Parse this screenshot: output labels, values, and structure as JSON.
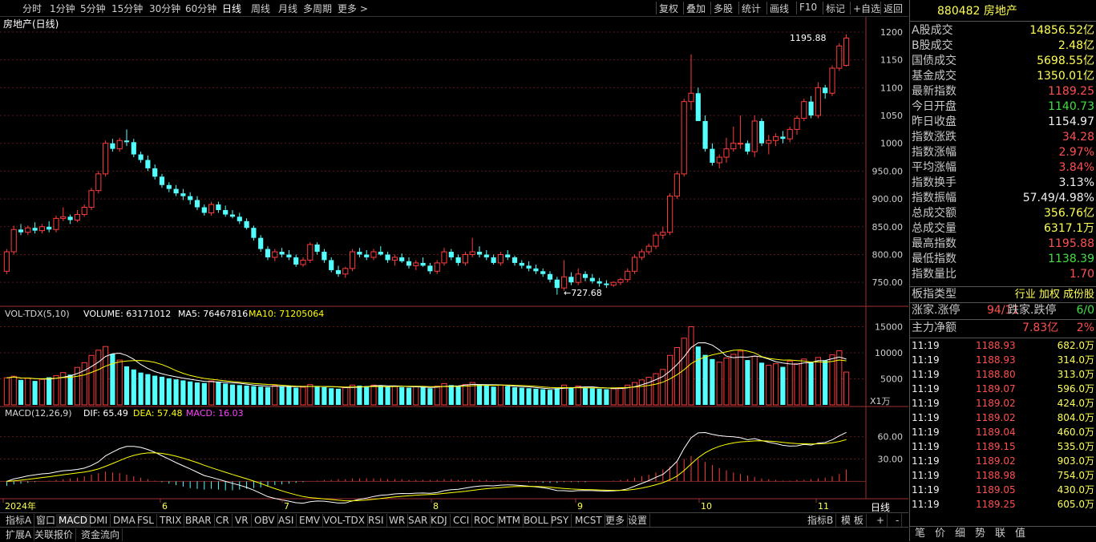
{
  "toolbar": {
    "periods": [
      "分时",
      "1分钟",
      "5分钟",
      "15分钟",
      "30分钟",
      "60分钟",
      "日线",
      "周线",
      "月线",
      "多周期",
      "更多 >"
    ],
    "active_period": "日线",
    "buttons": [
      "复权",
      "叠加",
      "多股",
      "统计",
      "画线",
      "F10",
      "标记",
      "+自选",
      "返回"
    ]
  },
  "chart": {
    "title": "房地产(日线)",
    "high_label": "1195.88",
    "low_label": "←727.68",
    "vol_header": {
      "prefix": "VOL-TDX(5,10)",
      "volume": "VOLUME: 63171012",
      "ma5": "MA5: 76467816",
      "ma10": "MA10: 71205064"
    },
    "vol_unit": "X1万",
    "macd_header": {
      "prefix": "MACD(12,26,9)",
      "dif": "DIF: 65.49",
      "dea": "DEA: 57.48",
      "macd": "MACD: 16.03"
    },
    "price_ticks": [
      "1200",
      "1150",
      "1100",
      "1050",
      "1000",
      "950.00",
      "900.00",
      "850.00",
      "800.00",
      "750.00"
    ],
    "vol_ticks": [
      "15000",
      "10000",
      "5000"
    ],
    "macd_ticks": [
      "60.00",
      "30.00"
    ],
    "date_labels": [
      "2024年",
      "6",
      "7",
      "8",
      "9",
      "10",
      "11"
    ],
    "period_label": "日线"
  },
  "chart_data": {
    "type": "candlestick",
    "title": "房地产(日线)",
    "ylim": [
      720,
      1210
    ],
    "high": 1195.88,
    "low": 727.68,
    "colors": {
      "up": "#ff3c3c",
      "down": "#54ffff",
      "ma5": "#ffffff",
      "ma10": "#ffff00",
      "dif": "#ffffff",
      "dea": "#ffff00"
    },
    "ohlc": [
      [
        770,
        810,
        765,
        805
      ],
      [
        805,
        852,
        800,
        845
      ],
      [
        845,
        855,
        835,
        840
      ],
      [
        840,
        852,
        835,
        848
      ],
      [
        848,
        858,
        838,
        843
      ],
      [
        843,
        855,
        838,
        850
      ],
      [
        850,
        860,
        840,
        845
      ],
      [
        845,
        870,
        840,
        865
      ],
      [
        865,
        885,
        860,
        868
      ],
      [
        868,
        872,
        855,
        862
      ],
      [
        862,
        880,
        858,
        872
      ],
      [
        872,
        890,
        868,
        885
      ],
      [
        885,
        920,
        880,
        915
      ],
      [
        915,
        950,
        910,
        945
      ],
      [
        945,
        1005,
        940,
        1000
      ],
      [
        1000,
        1008,
        985,
        990
      ],
      [
        990,
        1010,
        985,
        1005
      ],
      [
        1005,
        1025,
        995,
        1002
      ],
      [
        1002,
        1008,
        975,
        980
      ],
      [
        980,
        985,
        965,
        970
      ],
      [
        970,
        978,
        950,
        955
      ],
      [
        955,
        962,
        935,
        940
      ],
      [
        940,
        945,
        920,
        925
      ],
      [
        925,
        930,
        912,
        918
      ],
      [
        918,
        925,
        905,
        910
      ],
      [
        910,
        918,
        898,
        905
      ],
      [
        905,
        912,
        890,
        898
      ],
      [
        898,
        905,
        880,
        885
      ],
      [
        885,
        890,
        870,
        875
      ],
      [
        875,
        895,
        870,
        890
      ],
      [
        890,
        895,
        875,
        880
      ],
      [
        880,
        888,
        868,
        872
      ],
      [
        872,
        880,
        865,
        868
      ],
      [
        868,
        875,
        855,
        860
      ],
      [
        860,
        865,
        845,
        848
      ],
      [
        848,
        852,
        825,
        830
      ],
      [
        830,
        835,
        805,
        810
      ],
      [
        810,
        815,
        790,
        795
      ],
      [
        795,
        810,
        788,
        805
      ],
      [
        805,
        812,
        795,
        800
      ],
      [
        800,
        808,
        790,
        795
      ],
      [
        795,
        800,
        778,
        782
      ],
      [
        782,
        795,
        778,
        790
      ],
      [
        790,
        822,
        785,
        818
      ],
      [
        818,
        822,
        800,
        805
      ],
      [
        805,
        810,
        785,
        790
      ],
      [
        790,
        795,
        768,
        772
      ],
      [
        772,
        780,
        760,
        765
      ],
      [
        765,
        778,
        758,
        775
      ],
      [
        775,
        810,
        770,
        805
      ],
      [
        805,
        812,
        795,
        800
      ],
      [
        800,
        808,
        790,
        795
      ],
      [
        795,
        810,
        790,
        805
      ],
      [
        805,
        815,
        798,
        800
      ],
      [
        800,
        805,
        785,
        790
      ],
      [
        790,
        800,
        780,
        795
      ],
      [
        795,
        802,
        785,
        788
      ],
      [
        788,
        795,
        775,
        780
      ],
      [
        780,
        790,
        772,
        785
      ],
      [
        785,
        795,
        778,
        780
      ],
      [
        780,
        785,
        765,
        770
      ],
      [
        770,
        790,
        765,
        785
      ],
      [
        785,
        812,
        780,
        805
      ],
      [
        805,
        810,
        790,
        795
      ],
      [
        795,
        800,
        780,
        785
      ],
      [
        785,
        805,
        780,
        800
      ],
      [
        800,
        830,
        795,
        805
      ],
      [
        805,
        815,
        795,
        800
      ],
      [
        800,
        808,
        790,
        795
      ],
      [
        795,
        800,
        782,
        785
      ],
      [
        785,
        805,
        780,
        800
      ],
      [
        800,
        808,
        790,
        795
      ],
      [
        795,
        798,
        780,
        785
      ],
      [
        785,
        790,
        775,
        780
      ],
      [
        780,
        788,
        770,
        775
      ],
      [
        775,
        782,
        765,
        770
      ],
      [
        770,
        775,
        760,
        765
      ],
      [
        765,
        770,
        750,
        755
      ],
      [
        755,
        760,
        728,
        740
      ],
      [
        740,
        790,
        735,
        760
      ],
      [
        760,
        768,
        745,
        750
      ],
      [
        750,
        775,
        745,
        765
      ],
      [
        765,
        770,
        752,
        758
      ],
      [
        758,
        765,
        748,
        752
      ],
      [
        752,
        758,
        742,
        748
      ],
      [
        748,
        754,
        740,
        745
      ],
      [
        745,
        752,
        742,
        750
      ],
      [
        750,
        758,
        745,
        755
      ],
      [
        755,
        775,
        750,
        770
      ],
      [
        770,
        800,
        765,
        795
      ],
      [
        795,
        810,
        790,
        805
      ],
      [
        805,
        820,
        800,
        815
      ],
      [
        815,
        840,
        810,
        835
      ],
      [
        835,
        850,
        828,
        840
      ],
      [
        840,
        910,
        835,
        905
      ],
      [
        905,
        950,
        900,
        945
      ],
      [
        945,
        1080,
        940,
        1075
      ],
      [
        1075,
        1160,
        1060,
        1090
      ],
      [
        1090,
        1100,
        1045,
        1040
      ],
      [
        1040,
        1050,
        985,
        990
      ],
      [
        990,
        1000,
        960,
        965
      ],
      [
        965,
        980,
        955,
        975
      ],
      [
        975,
        1010,
        965,
        990
      ],
      [
        990,
        1030,
        985,
        1000
      ],
      [
        1000,
        1050,
        990,
        1000
      ],
      [
        1000,
        1005,
        980,
        985
      ],
      [
        985,
        1050,
        975,
        1040
      ],
      [
        1040,
        1045,
        995,
        1000
      ],
      [
        1000,
        1015,
        980,
        1005
      ],
      [
        1005,
        1018,
        995,
        1012
      ],
      [
        1012,
        1022,
        1000,
        1008
      ],
      [
        1008,
        1030,
        1002,
        1025
      ],
      [
        1025,
        1050,
        1015,
        1045
      ],
      [
        1045,
        1080,
        1040,
        1075
      ],
      [
        1075,
        1085,
        1045,
        1050
      ],
      [
        1050,
        1110,
        1045,
        1100
      ],
      [
        1100,
        1105,
        1080,
        1090
      ],
      [
        1090,
        1140,
        1085,
        1135
      ],
      [
        1135,
        1180,
        1130,
        1175
      ],
      [
        1140,
        1196,
        1138,
        1189
      ]
    ],
    "volume": [
      5200,
      5500,
      4800,
      5100,
      4600,
      4900,
      5300,
      5600,
      6200,
      5800,
      7200,
      8100,
      9500,
      10500,
      11200,
      9800,
      8600,
      7400,
      6800,
      6200,
      5900,
      5600,
      5400,
      5100,
      4900,
      4700,
      4500,
      4300,
      4200,
      4600,
      4400,
      4100,
      3900,
      3800,
      3700,
      3600,
      3500,
      3400,
      3700,
      3600,
      3500,
      3300,
      3400,
      3900,
      3600,
      3400,
      3200,
      3100,
      3300,
      3800,
      3700,
      3600,
      3800,
      3700,
      3500,
      3600,
      3400,
      3300,
      3500,
      3400,
      3200,
      3600,
      4100,
      3800,
      3600,
      3900,
      4300,
      3900,
      3700,
      3500,
      3800,
      3600,
      3400,
      3300,
      3200,
      3100,
      3000,
      2900,
      3200,
      3800,
      3400,
      3600,
      3300,
      3200,
      3100,
      3000,
      3100,
      3300,
      3800,
      4300,
      4800,
      5300,
      6000,
      6800,
      9500,
      11000,
      12800,
      15000,
      11200,
      9600,
      8800,
      8200,
      9000,
      9700,
      10300,
      8600,
      9300,
      8100,
      7600,
      7900,
      7300,
      8400,
      7900,
      8800,
      8300,
      9100,
      8500,
      9600,
      10400,
      6300
    ],
    "macd_hist": [
      -6,
      -4,
      -3,
      -2,
      -1,
      0,
      1,
      2,
      3,
      4,
      5,
      7,
      9,
      11,
      13,
      12,
      11,
      9,
      7,
      5,
      3,
      1,
      -1,
      -3,
      -5,
      -7,
      -9,
      -10,
      -11,
      -10,
      -11,
      -12,
      -12,
      -11,
      -10,
      -9,
      -8,
      -7,
      -5,
      -4,
      -3,
      -2,
      -1,
      0,
      1,
      2,
      2,
      3,
      3,
      4,
      4,
      4,
      4,
      4,
      3,
      3,
      3,
      2,
      2,
      2,
      2,
      2,
      3,
      3,
      2,
      2,
      3,
      2,
      2,
      1,
      1,
      1,
      0,
      0,
      -1,
      -1,
      -2,
      -2,
      -2,
      -1,
      -1,
      -1,
      -1,
      0,
      0,
      0,
      1,
      2,
      3,
      5,
      7,
      9,
      12,
      16,
      20,
      26,
      30,
      34,
      30,
      26,
      22,
      18,
      15,
      12,
      10,
      8,
      6,
      4,
      3,
      2,
      1,
      1,
      2,
      2,
      3,
      4,
      5,
      7,
      10,
      16
    ],
    "macd_range": [
      -20,
      80
    ]
  },
  "right_panel": {
    "code": "880482",
    "name": "房地产",
    "stats": [
      {
        "label": "A股成交",
        "value": "14856.52亿",
        "color": "yellow"
      },
      {
        "label": "B股成交",
        "value": "2.48亿",
        "color": "yellow"
      },
      {
        "label": "国债成交",
        "value": "5698.55亿",
        "color": "yellow"
      },
      {
        "label": "基金成交",
        "value": "1350.01亿",
        "color": "yellow"
      },
      {
        "label": "最新指数",
        "value": "1189.25",
        "color": "red"
      },
      {
        "label": "今日开盘",
        "value": "1140.73",
        "color": "green"
      },
      {
        "label": "昨日收盘",
        "value": "1154.97",
        "color": "white"
      },
      {
        "label": "指数涨跌",
        "value": "34.28",
        "color": "red"
      },
      {
        "label": "指数涨幅",
        "value": "2.97%",
        "color": "red"
      },
      {
        "label": "平均涨幅",
        "value": "3.84%",
        "color": "red"
      },
      {
        "label": "指数换手",
        "value": "3.13%",
        "color": "white"
      },
      {
        "label": "指数振幅",
        "value": "57.49/4.98%",
        "color": "white"
      },
      {
        "label": "总成交额",
        "value": "356.76亿",
        "color": "yellow"
      },
      {
        "label": "总成交量",
        "value": "6317.1万",
        "color": "yellow"
      },
      {
        "label": "最高指数",
        "value": "1195.88",
        "color": "red"
      },
      {
        "label": "最低指数",
        "value": "1138.39",
        "color": "green"
      },
      {
        "label": "指数量比",
        "value": "1.70",
        "color": "red"
      }
    ],
    "board_type_label": "板指类型",
    "board_type_value": "行业 加权 成份股",
    "rise_label": "涨家.涨停",
    "rise_value": "94/11",
    "fall_label": "跌家.跌停",
    "fall_value": "6/0",
    "net_label": "主力净额",
    "net_value": "7.83亿",
    "net_pct": "2%",
    "ticks": [
      {
        "time": "11:19",
        "price": "1188.93",
        "vol": "682.0万"
      },
      {
        "time": "11:19",
        "price": "1188.93",
        "vol": "314.0万"
      },
      {
        "time": "11:19",
        "price": "1188.80",
        "vol": "313.0万"
      },
      {
        "time": "11:19",
        "price": "1189.07",
        "vol": "596.0万"
      },
      {
        "time": "11:19",
        "price": "1189.02",
        "vol": "424.0万"
      },
      {
        "time": "11:19",
        "price": "1189.02",
        "vol": "804.0万"
      },
      {
        "time": "11:19",
        "price": "1189.04",
        "vol": "460.0万"
      },
      {
        "time": "11:19",
        "price": "1189.15",
        "vol": "535.0万"
      },
      {
        "time": "11:19",
        "price": "1189.02",
        "vol": "903.0万"
      },
      {
        "time": "11:19",
        "price": "1188.98",
        "vol": "754.0万"
      },
      {
        "time": "11:19",
        "price": "1189.05",
        "vol": "430.0万"
      },
      {
        "time": "11:19",
        "price": "1189.25",
        "vol": "605.0万"
      }
    ],
    "bottom_tabs": [
      "笔",
      "价",
      "细",
      "势",
      "联",
      "值"
    ]
  },
  "indicator_tabs": [
    "指标A",
    "窗口",
    "MACD",
    "DMI",
    "DMA",
    "FSL",
    "TRIX",
    "BRAR",
    "CR",
    "VR",
    "OBV",
    "ASI",
    "EMV",
    "VOL-TDX",
    "RSI",
    "WR",
    "SAR",
    "KDJ",
    "CCI",
    "ROC",
    "MTM",
    "BOLL",
    "PSY",
    "MCST",
    "更多",
    "设置"
  ],
  "indicator_right": [
    "指标B",
    "模 板",
    "+",
    "-"
  ],
  "bottom_row": [
    "扩展A",
    "关联报价",
    "资金流向"
  ]
}
